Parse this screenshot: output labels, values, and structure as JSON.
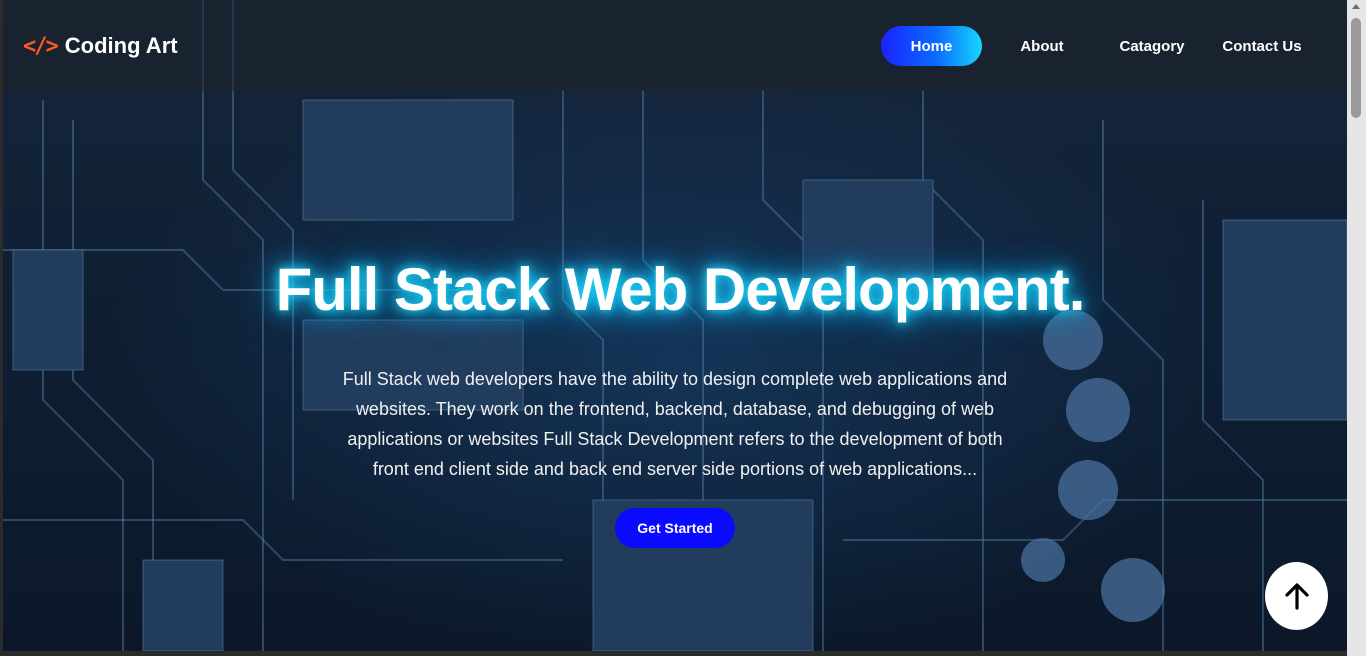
{
  "header": {
    "logo_icon": "</>",
    "logo_text": "Coding Art",
    "nav": [
      {
        "label": "Home",
        "active": true
      },
      {
        "label": "About",
        "active": false
      },
      {
        "label": "Catagory",
        "active": false
      },
      {
        "label": "Contact Us",
        "active": false
      }
    ]
  },
  "hero": {
    "title": "Full Stack Web Development.",
    "description": "Full Stack web developers have the ability to design complete web applications and websites. They work on the frontend, backend, database, and debugging of web applications or websites Full Stack Development refers to the development of both front end client side and back end server side portions of web applications...",
    "cta_label": "Get Started"
  },
  "icons": {
    "logo": "code-icon",
    "scroll_top": "arrow-up-icon"
  },
  "colors": {
    "accent": "#0a0aff",
    "logo_icon": "#ff5a1f",
    "title_glow": "#18e0ff"
  }
}
